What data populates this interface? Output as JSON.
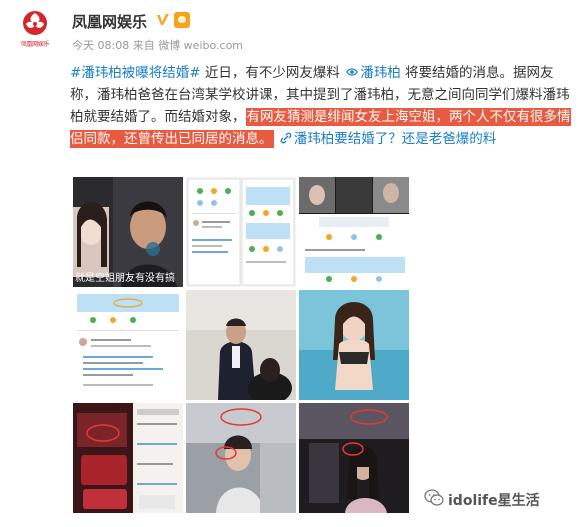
{
  "post": {
    "author": "凤凰网娱乐",
    "meta": "今天 08:08 来自 微博 weibo.com",
    "logo_caption": "凤凰网娱乐",
    "text": {
      "tag1": "#潘玮柏被曝将结婚#",
      "t1": " 近日，有不少网友爆料 ",
      "tag2": "潘玮柏",
      "t2": " 将要结婚的消息。据网友称，潘玮柏爸爸在台湾某学校讲课，其中提到了潘玮柏，无意之间向同学们爆料潘玮柏就要结婚了。而结婚对象，",
      "highlight": "有网友猜测是绯闻女友上海空姐，两个人不仅有很多情侣同款，还曾传出已同居的消息。",
      "t3": " ",
      "link": "潘玮柏要结婚了？还是老爸爆的料"
    },
    "images": {
      "c1_caption": "就是空姐朋友有没有搞"
    }
  },
  "watermark": {
    "text": "idolife星生活",
    "icon": "wechat-icon"
  },
  "colors": {
    "link": "#1a7ec9",
    "highlight_bg": "#ea5a40",
    "brand_red": "#c8161e"
  }
}
